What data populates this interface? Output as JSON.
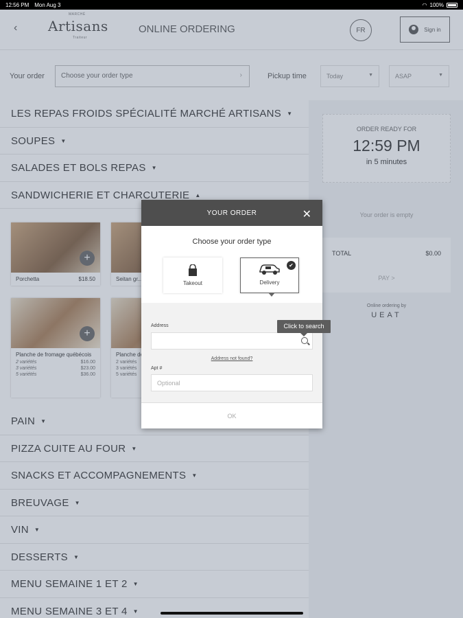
{
  "status": {
    "time": "12:56 PM",
    "date": "Mon Aug 3",
    "battery": "100%"
  },
  "header": {
    "logo": "Artisans",
    "logo_top": "MARCHÉ",
    "logo_sub": "Traiteur",
    "title": "ONLINE ORDERING",
    "lang": "FR",
    "signin": "Sign in"
  },
  "order_bar": {
    "your_order_label": "Your order",
    "order_type_value": "Choose your order type",
    "pickup_label": "Pickup time",
    "day": "Today",
    "time": "ASAP"
  },
  "categories_top": [
    {
      "label": "LES REPAS FROIDS SPÉCIALITÉ MARCHÉ ARTISANS"
    },
    {
      "label": "SOUPES"
    },
    {
      "label": "SALADES ET BOLS REPAS"
    },
    {
      "label": "SANDWICHERIE ET CHARCUTERIE"
    }
  ],
  "products": [
    {
      "name": "Porchetta",
      "price": "$18.50"
    },
    {
      "name": "Seitan gr..."
    },
    {
      "name": "Planche de fromage québécois",
      "variants": [
        [
          "2 variétés",
          "$16.00"
        ],
        [
          "3 variétés",
          "$23.00"
        ],
        [
          "5 variétés",
          "$36.00"
        ]
      ]
    },
    {
      "name": "Planche de québécois",
      "variants": [
        [
          "2 variétés",
          ""
        ],
        [
          "3 variétés",
          ""
        ],
        [
          "5 variétés",
          ""
        ]
      ]
    }
  ],
  "categories_bottom": [
    {
      "label": "PAIN"
    },
    {
      "label": "PIZZA CUITE AU FOUR"
    },
    {
      "label": "SNACKS ET ACCOMPAGNEMENTS"
    },
    {
      "label": "BREUVAGE"
    },
    {
      "label": "VIN"
    },
    {
      "label": "DESSERTS"
    },
    {
      "label": "MENU SEMAINE 1 ET 2"
    },
    {
      "label": "MENU SEMAINE 3 ET 4"
    }
  ],
  "sidebar": {
    "ready_label": "ORDER READY FOR",
    "ready_time": "12:59 PM",
    "ready_in": "in 5 minutes",
    "empty": "Your order is empty",
    "total_label": "TOTAL",
    "total_value": "$0.00",
    "pay": "PAY >",
    "powered_by": "Online ordering by",
    "brand": "UEAT"
  },
  "modal": {
    "title": "YOUR ORDER",
    "subtitle": "Choose your order type",
    "takeout": "Takeout",
    "delivery": "Delivery",
    "address_label": "Address",
    "address_not_found": "Address not found?",
    "apt_label": "Apt #",
    "apt_placeholder": "Optional",
    "ok": "OK"
  },
  "tooltip": "Click to search"
}
